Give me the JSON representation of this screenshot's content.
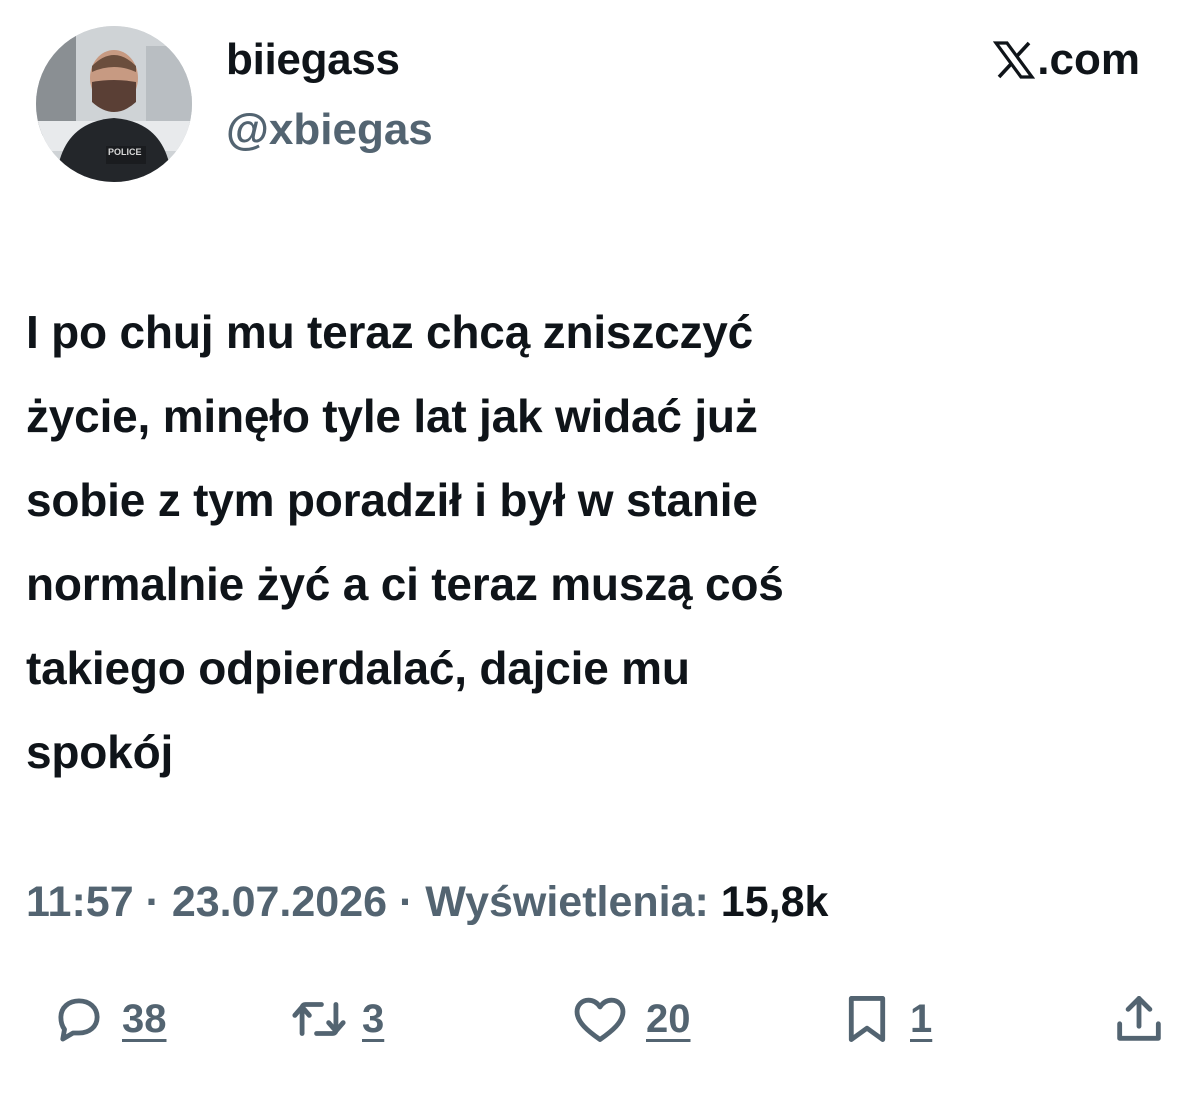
{
  "author": {
    "display_name": "biiegass",
    "handle": "@xbiegas",
    "avatar_badge_text": "POLICE"
  },
  "source": {
    "label": ".com",
    "logo": "x-logo"
  },
  "tweet": {
    "text": "I po chuj mu teraz chcą zniszczyć\nżycie, minęło tyle lat jak widać już\nsobie z tym poradził i był w stanie\nnormalnie żyć a ci teraz muszą coś\ntakiego odpierdalać, dajcie mu\nspokój"
  },
  "meta": {
    "time": "11:57",
    "separator": " · ",
    "date": "23.07.2026",
    "views_label": "Wyświetlenia:",
    "views_count": "15,8k"
  },
  "actions": {
    "replies": {
      "icon": "reply-icon",
      "count": "38"
    },
    "reposts": {
      "icon": "repost-icon",
      "count": "3"
    },
    "likes": {
      "icon": "heart-icon",
      "count": "20"
    },
    "bookmarks": {
      "icon": "bookmark-icon",
      "count": "1"
    },
    "share": {
      "icon": "share-icon"
    }
  },
  "colors": {
    "text_primary": "#0f1419",
    "text_secondary": "#536471",
    "background": "#ffffff"
  }
}
